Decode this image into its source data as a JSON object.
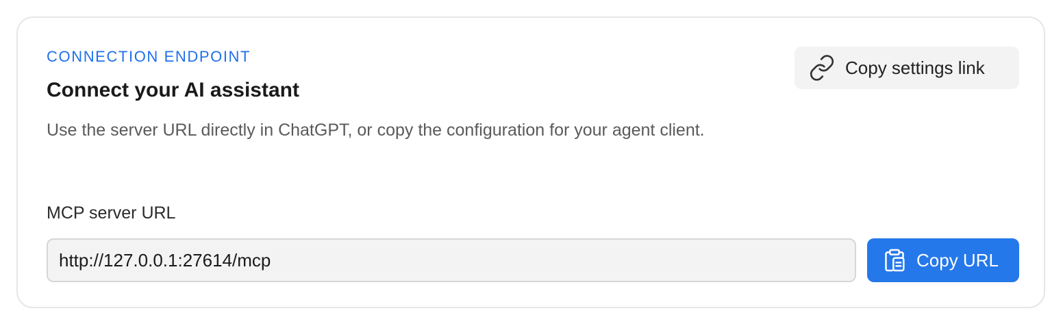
{
  "card": {
    "eyebrow": "CONNECTION ENDPOINT",
    "title": "Connect your AI assistant",
    "description": "Use the server URL directly in ChatGPT, or copy the configuration for your agent client.",
    "settings_button": {
      "label": "Copy settings link",
      "icon": "link-icon"
    },
    "url_field": {
      "label": "MCP server URL",
      "value": "http://127.0.0.1:27614/mcp"
    },
    "copy_button": {
      "label": "Copy URL",
      "icon": "clipboard-icon"
    }
  },
  "colors": {
    "accent": "#2478ea",
    "eyebrow": "#1f6feb",
    "border": "#e6e6e6",
    "muted_text": "#5a5a5a",
    "input_bg": "#f3f3f3"
  }
}
